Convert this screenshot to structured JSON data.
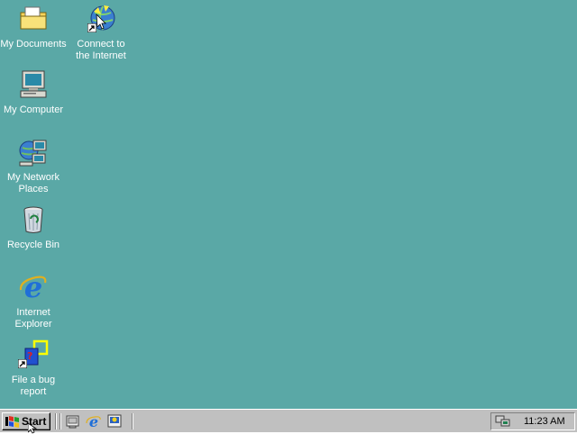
{
  "desktop": {
    "background_color": "#5aa8a6",
    "icons": [
      {
        "name": "my-documents",
        "label": "My Documents",
        "icon": "folder-icon"
      },
      {
        "name": "connect-internet",
        "label": "Connect to\nthe Internet",
        "icon": "connect-wizard-icon"
      },
      {
        "name": "my-computer",
        "label": "My Computer",
        "icon": "computer-icon"
      },
      {
        "name": "network-places",
        "label": "My Network\nPlaces",
        "icon": "network-icon"
      },
      {
        "name": "recycle-bin",
        "label": "Recycle Bin",
        "icon": "recycle-bin-icon"
      },
      {
        "name": "internet-explorer",
        "label": "Internet\nExplorer",
        "icon": "ie-icon"
      },
      {
        "name": "file-bug",
        "label": "File a bug\nreport",
        "icon": "bug-report-icon"
      }
    ]
  },
  "taskbar": {
    "start_label": "Start",
    "quick_launch": [
      "desktop-icon",
      "ie-icon",
      "channels-icon"
    ],
    "clock": "11:23 AM"
  }
}
